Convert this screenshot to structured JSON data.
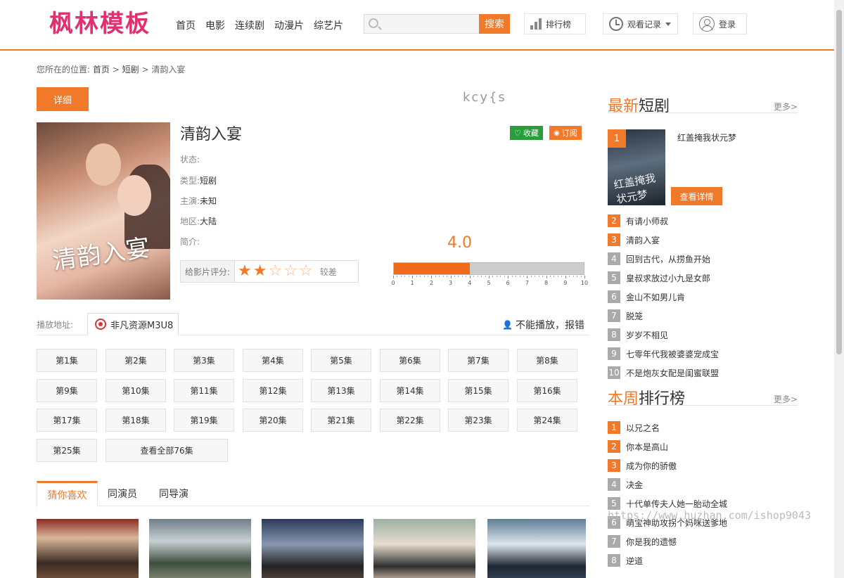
{
  "logo": "枫林模板",
  "nav": [
    "首页",
    "电影",
    "连续剧",
    "动漫片",
    "综艺片"
  ],
  "search": {
    "placeholder": "",
    "button": "搜索"
  },
  "header_buttons": {
    "rank": "排行榜",
    "history": "观看记录",
    "login": "登录"
  },
  "breadcrumb": {
    "prefix": "您所在的位置:",
    "home": "首页",
    "sep": ">",
    "category": "短剧",
    "current": "清韵入宴"
  },
  "detail_tab": "详细",
  "top_watermark": "kcy{s",
  "movie": {
    "title": "清韵入宴",
    "poster_text": "清韵入宴",
    "fav": "收藏",
    "subscribe": "订阅",
    "fields": [
      {
        "label": "状态:",
        "value": ""
      },
      {
        "label": "类型:",
        "value": "短剧"
      },
      {
        "label": "主演:",
        "value": "未知"
      },
      {
        "label": "地区:",
        "value": "大陆"
      },
      {
        "label": "简介:",
        "value": ""
      }
    ]
  },
  "rating": {
    "label": "给影片评分:",
    "stars_filled": 2,
    "stars_total": 5,
    "text": "较差",
    "score": "4.0",
    "score_value": 4.0,
    "scale_max": 10,
    "ticks": [
      "0",
      "1",
      "2",
      "3",
      "4",
      "5",
      "6",
      "7",
      "8",
      "9",
      "10"
    ]
  },
  "play": {
    "label": "播放地址:",
    "source": "非凡资源M3U8",
    "report": "不能播放，报错",
    "episodes": [
      "第1集",
      "第2集",
      "第3集",
      "第4集",
      "第5集",
      "第6集",
      "第7集",
      "第8集",
      "第9集",
      "第10集",
      "第11集",
      "第12集",
      "第13集",
      "第14集",
      "第15集",
      "第16集",
      "第17集",
      "第18集",
      "第19集",
      "第20集",
      "第21集",
      "第22集",
      "第23集",
      "第24集",
      "第25集"
    ],
    "view_all": "查看全部76集"
  },
  "bottom_tabs": [
    "猜你喜欢",
    "同演员",
    "同导演"
  ],
  "sidebar": {
    "latest": {
      "title_accent": "最新",
      "title_rest": "短剧",
      "more": "更多>",
      "featured": {
        "rank": "1",
        "title": "红盖掩我状元梦",
        "poster_text": "红盖掩我状元梦",
        "button": "查看详情"
      },
      "items": [
        {
          "rank": "2",
          "title": "有请小师叔"
        },
        {
          "rank": "3",
          "title": "清韵入宴"
        },
        {
          "rank": "4",
          "title": "回到古代，从捞鱼开始"
        },
        {
          "rank": "5",
          "title": "皇叔求放过小九是女郎"
        },
        {
          "rank": "6",
          "title": "金山不如男儿肯"
        },
        {
          "rank": "7",
          "title": "脱笼"
        },
        {
          "rank": "8",
          "title": "岁岁不相见"
        },
        {
          "rank": "9",
          "title": "七零年代我被婆婆宠成宝"
        },
        {
          "rank": "10",
          "title": "不是炮灰女配是闺蜜联盟"
        }
      ]
    },
    "weekly": {
      "title_accent": "本周",
      "title_rest": "排行榜",
      "more": "更多>",
      "items": [
        {
          "rank": "1",
          "title": "以兄之名"
        },
        {
          "rank": "2",
          "title": "你本是高山"
        },
        {
          "rank": "3",
          "title": "成为你的骄傲"
        },
        {
          "rank": "4",
          "title": "决金"
        },
        {
          "rank": "5",
          "title": "十代单传夫人她一胎动全城"
        },
        {
          "rank": "6",
          "title": "萌宝神助攻拐个妈咪送爹地"
        },
        {
          "rank": "7",
          "title": "你是我的遗憾"
        },
        {
          "rank": "8",
          "title": "逆道"
        }
      ]
    }
  },
  "watermark": "https://www.huzhan.com/ishop9043",
  "colors": {
    "accent": "#f07a2a",
    "logo": "#e0306e",
    "fav": "#2a9d3a"
  }
}
